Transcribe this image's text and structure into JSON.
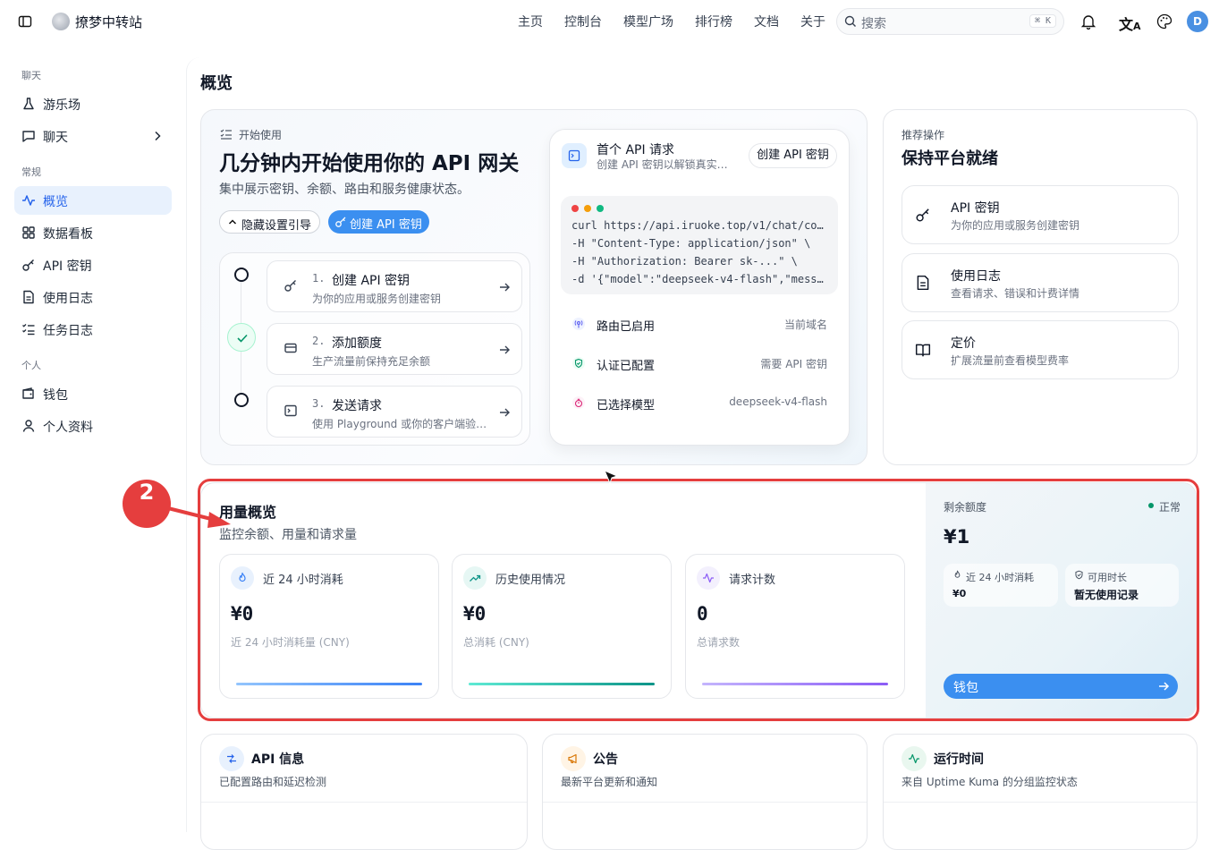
{
  "header": {
    "site_name": "撩梦中转站",
    "nav": [
      "主页",
      "控制台",
      "模型广场",
      "排行榜",
      "文档",
      "关于"
    ],
    "search_placeholder": "搜索",
    "search_shortcut": "⌘ K",
    "avatar_initial": "D"
  },
  "sidebar": {
    "groups": [
      {
        "label": "聊天",
        "items": [
          "游乐场",
          "聊天"
        ]
      },
      {
        "label": "常规",
        "items": [
          "概览",
          "数据看板",
          "API 密钥",
          "使用日志",
          "任务日志"
        ]
      },
      {
        "label": "个人",
        "items": [
          "钱包",
          "个人资料"
        ]
      }
    ],
    "active": "概览"
  },
  "page": {
    "title": "概览"
  },
  "getting_started": {
    "eyebrow": "开始使用",
    "heading": "几分钟内开始使用你的 API 网关",
    "subtitle": "集中展示密钥、余额、路由和服务健康状态。",
    "hide_guide": "隐藏设置引导",
    "create_key": "创建 API 密钥",
    "steps": [
      {
        "num": "1.",
        "title": "创建 API 密钥",
        "desc": "为你的应用或服务创建密钥",
        "done": false
      },
      {
        "num": "2.",
        "title": "添加额度",
        "desc": "生产流量前保持充足余额",
        "done": true
      },
      {
        "num": "3.",
        "title": "发送请求",
        "desc": "使用 Playground 或你的客户端验…",
        "done": false
      }
    ]
  },
  "first_request": {
    "title": "首个 API 请求",
    "desc": "创建 API 密钥以解锁真实…",
    "button": "创建 API 密钥",
    "code": [
      "curl https://api.iruoke.top/v1/chat/co…",
      "-H \"Content-Type: application/json\" \\",
      "-H \"Authorization: Bearer sk-...\" \\",
      "-d '{\"model\":\"deepseek-v4-flash\",\"mess…"
    ],
    "status": [
      {
        "label": "路由已启用",
        "value": "当前域名"
      },
      {
        "label": "认证已配置",
        "value": "需要 API 密钥"
      },
      {
        "label": "已选择模型",
        "value": "deepseek-v4-flash"
      }
    ]
  },
  "recommended": {
    "eyebrow": "推荐操作",
    "heading": "保持平台就绪",
    "items": [
      {
        "title": "API 密钥",
        "desc": "为你的应用或服务创建密钥"
      },
      {
        "title": "使用日志",
        "desc": "查看请求、错误和计费详情"
      },
      {
        "title": "定价",
        "desc": "扩展流量前查看模型费率"
      }
    ]
  },
  "usage": {
    "annotation_number": "2",
    "title": "用量概览",
    "subtitle": "监控余额、用量和请求量",
    "stats": [
      {
        "title": "近 24 小时消耗",
        "value": "¥0",
        "desc": "近 24 小时消耗量 (CNY)"
      },
      {
        "title": "历史使用情况",
        "value": "¥0",
        "desc": "总消耗 (CNY)"
      },
      {
        "title": "请求计数",
        "value": "0",
        "desc": "总请求数"
      }
    ],
    "balance": {
      "label": "剩余额度",
      "status": "正常",
      "amount": "¥1",
      "sub1_label": "近 24 小时消耗",
      "sub1_value": "¥0",
      "sub2_label": "可用时长",
      "sub2_value": "暂无使用记录",
      "wallet_button": "钱包"
    }
  },
  "bottom_cards": [
    {
      "title": "API 信息",
      "desc": "已配置路由和延迟检测"
    },
    {
      "title": "公告",
      "desc": "最新平台更新和通知"
    },
    {
      "title": "运行时间",
      "desc": "来自 Uptime Kuma 的分组监控状态"
    }
  ],
  "colors": {
    "accent": "#3b82f6",
    "annotation_red": "#e53e3e",
    "ok_green": "#059669"
  }
}
